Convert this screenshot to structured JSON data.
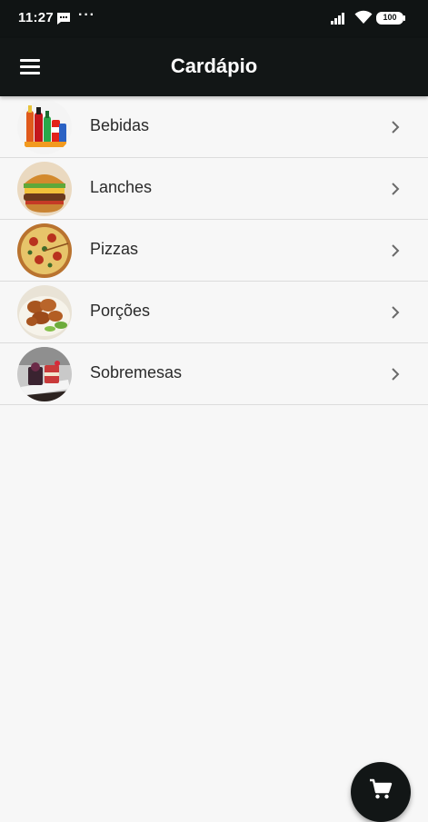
{
  "status_bar": {
    "time": "11:27",
    "more": "···",
    "battery": "100"
  },
  "app_bar": {
    "title": "Cardápio"
  },
  "menu": {
    "items": [
      {
        "label": "Bebidas",
        "image": "drinks-image"
      },
      {
        "label": "Lanches",
        "image": "burger-image"
      },
      {
        "label": "Pizzas",
        "image": "pizza-image"
      },
      {
        "label": "Porções",
        "image": "portions-image"
      },
      {
        "label": "Sobremesas",
        "image": "desserts-image"
      }
    ]
  },
  "fab": {
    "icon": "cart-icon"
  }
}
